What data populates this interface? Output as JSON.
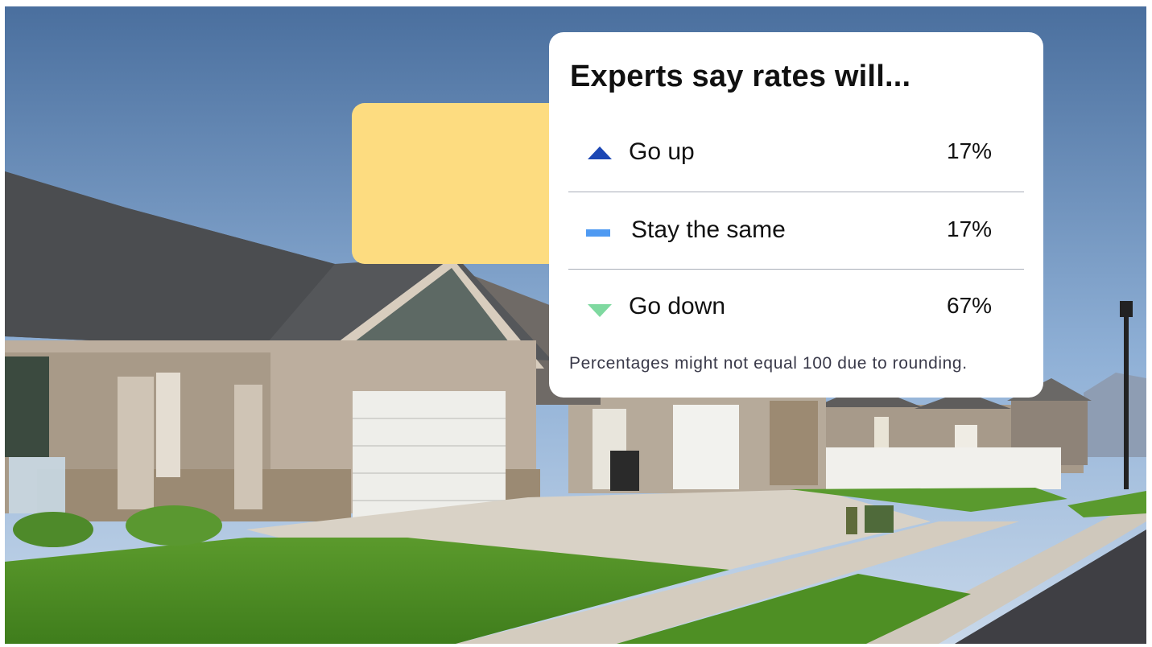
{
  "card": {
    "title": "Experts say rates will...",
    "rows": [
      {
        "label": "Go up",
        "value": "17%",
        "icon": "triangle-up-icon",
        "icon_color": "#1c47b4"
      },
      {
        "label": "Stay the same",
        "value": "17%",
        "icon": "dash-icon",
        "icon_color": "#4f9af2"
      },
      {
        "label": "Go down",
        "value": "67%",
        "icon": "triangle-down-icon",
        "icon_color": "#7fd9a0"
      }
    ],
    "footnote": "Percentages might not equal 100 due to rounding."
  },
  "colors": {
    "accent_block": "#fddc80",
    "card_background": "#ffffff"
  }
}
